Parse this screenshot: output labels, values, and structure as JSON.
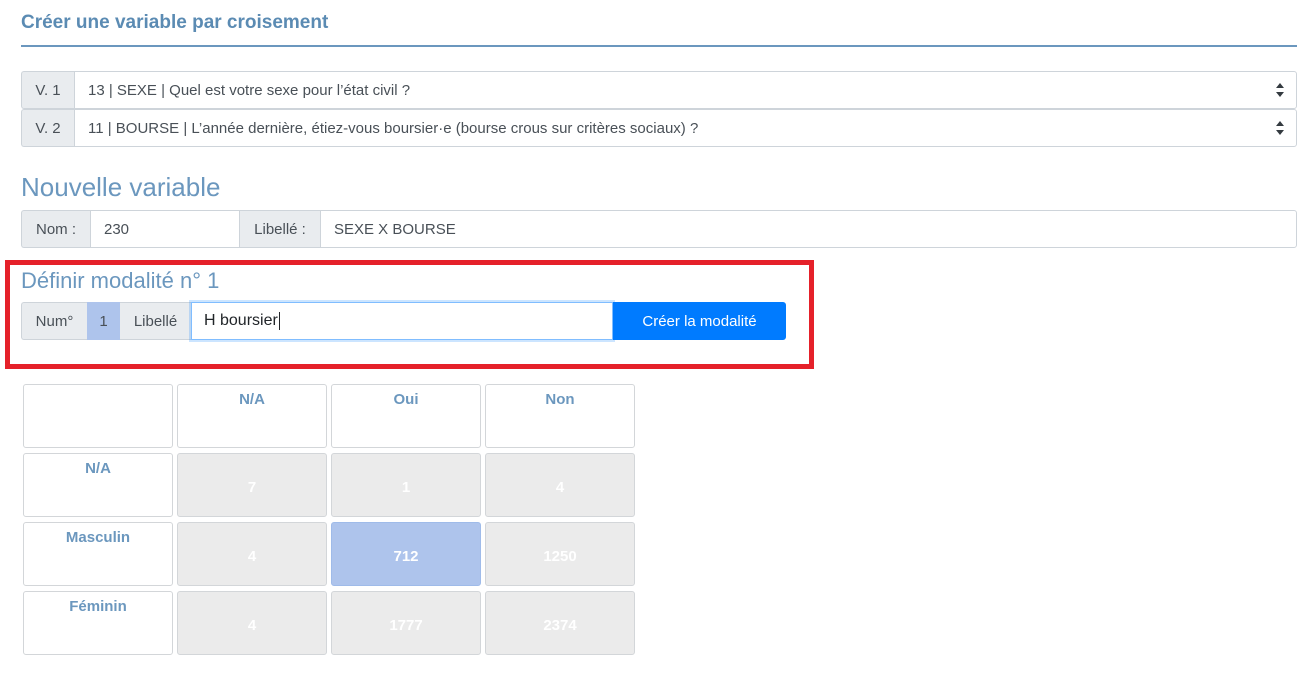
{
  "header": {
    "title": "Créer une variable par croisement"
  },
  "selectors": [
    {
      "prefix": "V. 1",
      "value": "13 | SEXE | Quel est votre sexe pour l’état civil ?"
    },
    {
      "prefix": "V. 2",
      "value": "11 | BOURSE | L’année dernière, étiez-vous boursier·e (bourse crous sur critères sociaux) ?"
    }
  ],
  "new_variable": {
    "title": "Nouvelle variable",
    "name_label": "Nom :",
    "name_value": "230",
    "label_label": "Libellé :",
    "label_value": "SEXE X BOURSE"
  },
  "modality": {
    "title": "Définir modalité n° 1",
    "num_label": "Num°",
    "num_value": "1",
    "label_label": "Libellé",
    "input_value": "H boursier",
    "create_button": "Créer la modalité"
  },
  "crosstab": {
    "col_headers": [
      "N/A",
      "Oui",
      "Non"
    ],
    "rows": [
      {
        "label": "N/A",
        "values": [
          "7",
          "1",
          "4"
        ]
      },
      {
        "label": "Masculin",
        "values": [
          "4",
          "712",
          "1250"
        ]
      },
      {
        "label": "Féminin",
        "values": [
          "4",
          "1777",
          "2374"
        ]
      }
    ],
    "selected_cell": {
      "row": 1,
      "col": 1
    }
  },
  "colors": {
    "accent_blue": "#6b97be",
    "primary_button": "#007bff",
    "highlight_red": "#e5212a",
    "selected_cell": "#aec4ec"
  }
}
